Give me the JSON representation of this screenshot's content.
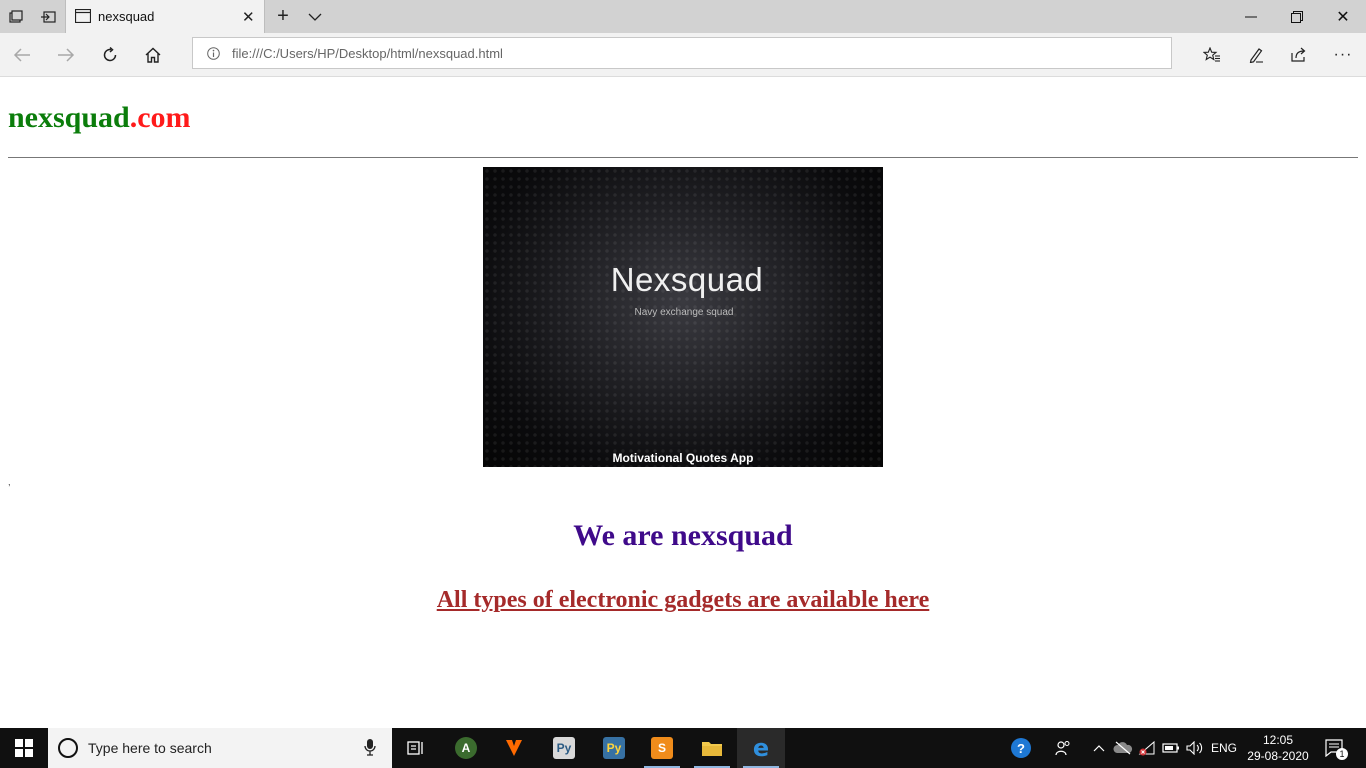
{
  "browser": {
    "tab_title": "nexsquad",
    "url": "file:///C:/Users/HP/Desktop/html/nexsquad.html"
  },
  "page": {
    "site_name": "nexsquad",
    "site_tld": ".com",
    "banner": {
      "title": "Nexsquad",
      "subtitle": "Navy exchange squad",
      "footer": "Motivational Quotes App"
    },
    "tiny_mark": ",",
    "heading": "We are nexsquad",
    "subheading": "All types of electronic gadgets are available here"
  },
  "taskbar": {
    "search_placeholder": "Type here to search",
    "language": "ENG",
    "time": "12:05",
    "date": "29-08-2020",
    "notification_count": "1"
  },
  "colors": {
    "site_name": "#0b7d0b",
    "site_tld": "#ff1a1a",
    "heading": "#3f0a8a",
    "subheading": "#a52a2a"
  }
}
